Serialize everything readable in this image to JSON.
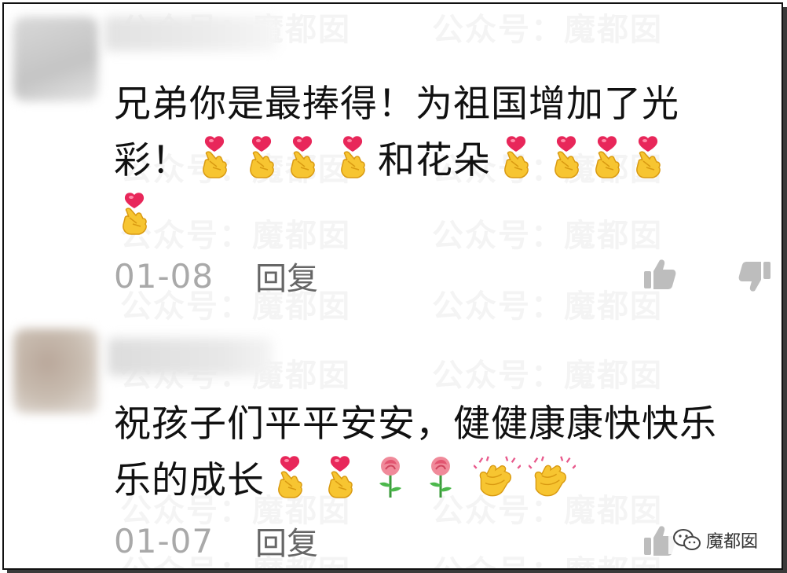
{
  "watermark": "公众号：魔都囡",
  "comments": [
    {
      "text_line1": "兄弟你是最捧得！为祖国增加了光",
      "text_line2_prefix": "彩！",
      "text_line2_mid": "和花朵",
      "date": "01-08",
      "reply_label": "回复"
    },
    {
      "text_line1": "祝孩子们平平安安，健健康康快快乐",
      "text_line2_prefix": "乐的成长",
      "date": "01-07",
      "reply_label": "回复"
    }
  ],
  "brand": {
    "name": "魔都囡",
    "icon": "wechat-icon"
  },
  "icons": {
    "like": "thumbs-up-icon",
    "dislike": "thumbs-down-icon",
    "finger_heart": "finger-heart-emoji",
    "rose": "rose-emoji",
    "clap": "clapping-hands-emoji"
  },
  "colors": {
    "text": "#111111",
    "meta": "#a9a9a9",
    "reply": "#666666",
    "icon": "#bdbdbd"
  }
}
